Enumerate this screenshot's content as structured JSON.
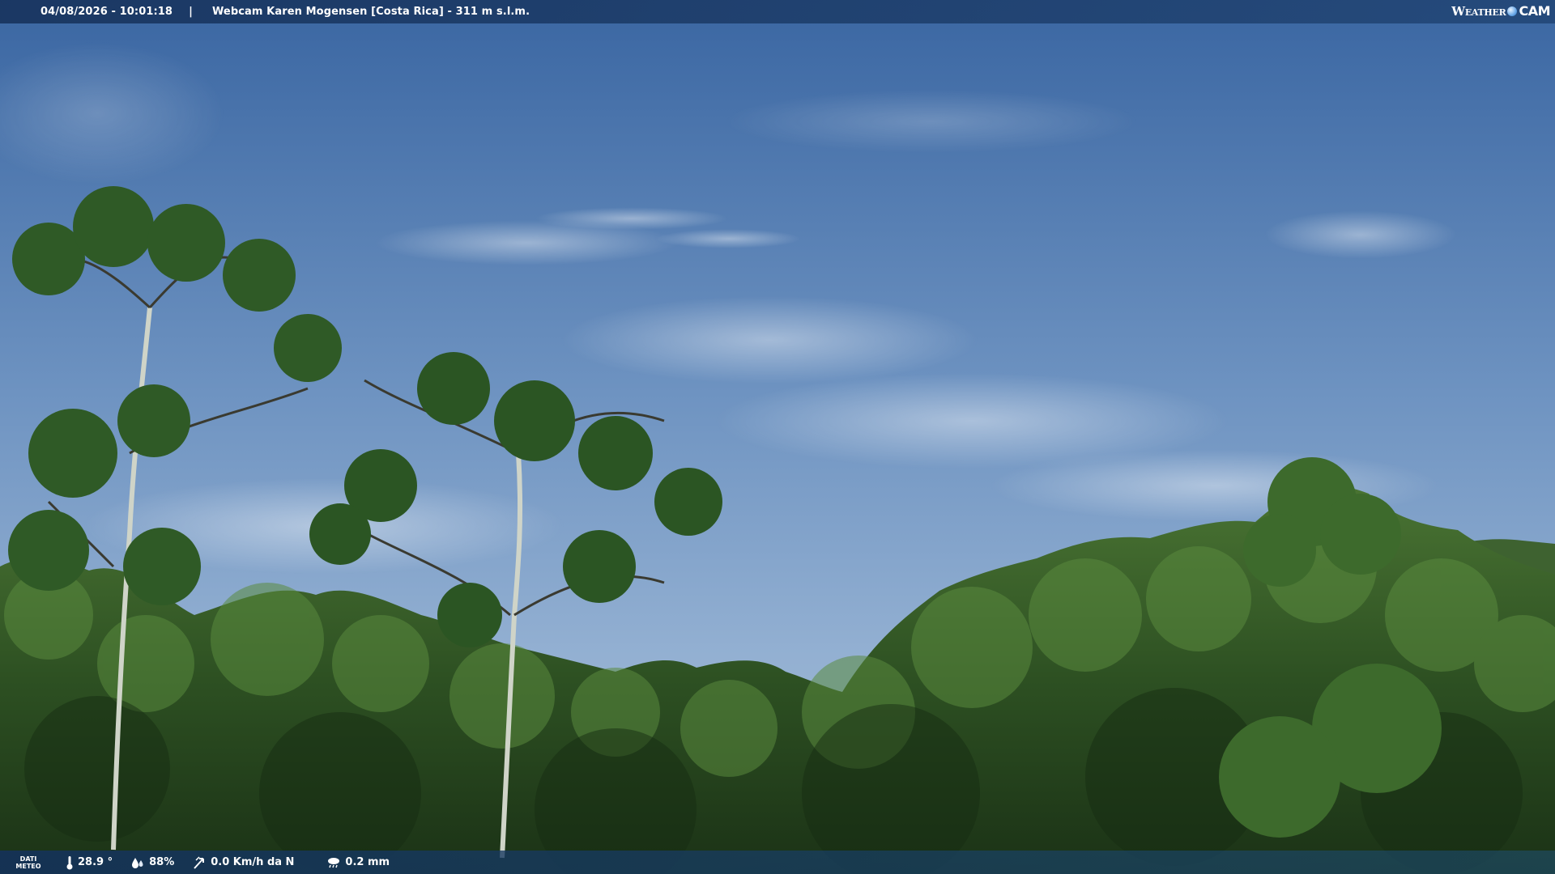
{
  "header": {
    "datetime": "04/08/2026 - 10:01:18",
    "separator": "|",
    "title": "Webcam Karen Mogensen [Costa Rica]  - 311 m s.l.m."
  },
  "logo": {
    "part1": "Weather",
    "part2": "CAM"
  },
  "footer": {
    "label_line1": "DATI",
    "label_line2": "METEO",
    "temperature": "28.9 °",
    "humidity": "88%",
    "wind": "0.0 Km/h da N",
    "rain": "0.2 mm"
  },
  "icons": {
    "temperature": "thermometer-icon",
    "humidity": "droplets-icon",
    "wind": "wind-vane-icon",
    "rain": "rain-cloud-icon"
  },
  "colors": {
    "sky_top": "#3d6aa6",
    "sky_mid": "#7e9fc6",
    "foliage_dark": "#1e3a1a",
    "foliage_light": "#4e7a35",
    "bar": "#1d3d6a"
  }
}
